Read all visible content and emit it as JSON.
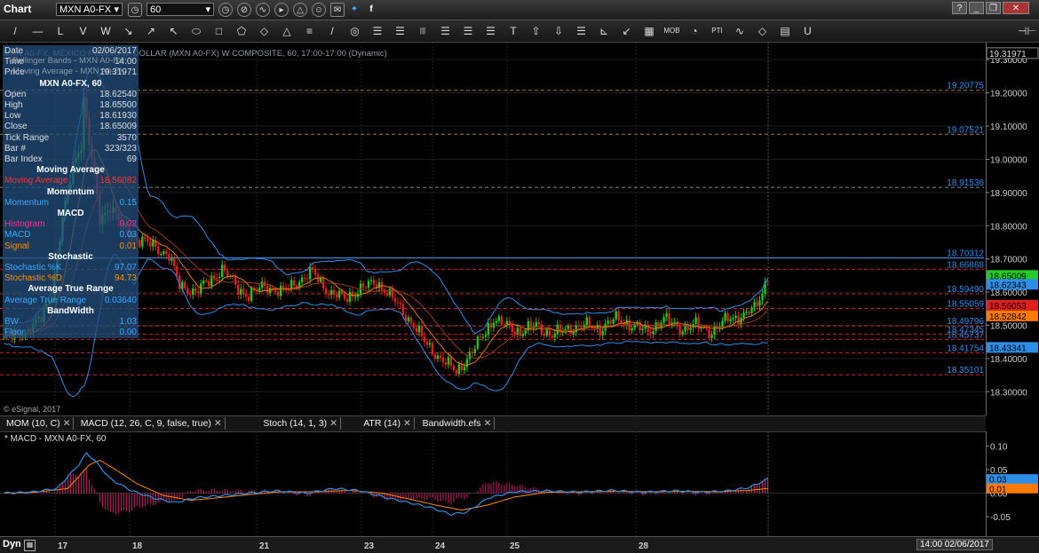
{
  "titlebar": {
    "app_title": "Chart",
    "symbol": "MXN A0-FX",
    "interval": "60",
    "window_buttons": [
      "?",
      "_",
      "❐",
      "✕"
    ]
  },
  "toolbar": {
    "tools": [
      "/",
      "—",
      "L",
      "V",
      "W",
      "↘",
      "↗",
      "↖",
      "⬭",
      "□",
      "⬠",
      "◇",
      "△",
      "≡",
      "/",
      "◎",
      "☰",
      "☰",
      "|||",
      "☰",
      "☰",
      "☰",
      "T",
      "⇧",
      "⇩",
      "☰",
      "⊾",
      "↙",
      "▦",
      "MOB",
      "◔",
      "PTI",
      "∿",
      "◇",
      "▤",
      "U"
    ],
    "right_tools": [
      "⊣⊢"
    ]
  },
  "legend_text": "MXN A0-FX, MEXICO PESO/U.S. DOLLAR (MXN A0-FX) W COMPOSITE, 60, 17:00-17:00 (Dynamic)",
  "data_window": {
    "rows": [
      {
        "k": "Date",
        "v": "02/06/2017"
      },
      {
        "k": "Time",
        "v": "14:00"
      },
      {
        "k": "Price",
        "v": "19.31971"
      },
      {
        "h": "MXN A0-FX, 60"
      },
      {
        "k": "Open",
        "v": "18.62540"
      },
      {
        "k": "High",
        "v": "18.65500"
      },
      {
        "k": "Low",
        "v": "18.61930"
      },
      {
        "k": "Close",
        "v": "18.65009"
      },
      {
        "k": "Tick Range",
        "v": "3570"
      },
      {
        "k": "Bar #",
        "v": "323/323"
      },
      {
        "k": "Bar Index",
        "v": "69"
      },
      {
        "h": "Moving Average"
      },
      {
        "k": "Moving Average",
        "v": "18.56082",
        "c": "#ff3030"
      },
      {
        "h": "Momentum"
      },
      {
        "k": "Momentum",
        "v": "0.15",
        "c": "#33aaff"
      },
      {
        "h": "MACD"
      },
      {
        "k": "Histogram",
        "v": "0.02",
        "c": "#ff2a8a"
      },
      {
        "k": "MACD",
        "v": "0.03",
        "c": "#33aaff"
      },
      {
        "k": "Signal",
        "v": "0.01",
        "c": "#ff8c00"
      },
      {
        "h": "Stochastic"
      },
      {
        "k": "Stochastic %K",
        "v": "97.07",
        "c": "#33aaff"
      },
      {
        "k": "Stochastic %D",
        "v": "94.73",
        "c": "#ff8c00"
      },
      {
        "h": "Average True Range"
      },
      {
        "k": "Average True Range",
        "v": "0.03640",
        "c": "#33aaff"
      },
      {
        "h": "BandWidth"
      },
      {
        "k": "BW",
        "v": "1.03",
        "c": "#33aaff"
      },
      {
        "k": "Floor",
        "v": "0.00",
        "c": "#33aaff"
      }
    ],
    "overlay_labels": [
      "Bollinger Bands - MXN A0-FX",
      "Moving Average - MXN A0-FX"
    ]
  },
  "watermark": "© eSignal, 2017",
  "tabs": [
    {
      "label": "MOM (10, C)"
    },
    {
      "label": "MACD (12, 26, C, 9, false, true)"
    },
    {
      "label": "Stoch (14, 1, 3)"
    },
    {
      "label": "ATR (14)"
    },
    {
      "label": "Bandwidth.efs"
    }
  ],
  "bottom_bar": {
    "dyn": "Dyn",
    "datetime": "14:00 02/06/2017"
  },
  "colors": {
    "up": "#1ec81e",
    "down": "#e02020",
    "band": "#2d8ee8",
    "ma": "#e07a10",
    "level_blue": "#2d8ee8",
    "level_red": "#d02020",
    "level_orange": "#a87a20"
  },
  "chart_data": [
    {
      "type": "candlestick",
      "ylim": [
        18.25,
        19.33
      ],
      "y_ticks": [
        "19.30000",
        "19.20000",
        "19.10000",
        "19.00000",
        "18.90000",
        "18.80000",
        "18.70000",
        "18.60000",
        "18.50000",
        "18.40000",
        "18.30000"
      ],
      "x_labels": [
        "17",
        "18",
        "21",
        "23",
        "24",
        "25",
        "28"
      ],
      "levels": [
        {
          "value": 19.20775,
          "label": "19.20775",
          "kind": "orange"
        },
        {
          "value": 19.07521,
          "label": "19.07521",
          "kind": "orange"
        },
        {
          "value": 18.91536,
          "label": "18.91536",
          "kind": "gray"
        },
        {
          "value": 18.70312,
          "label": "18.70312",
          "kind": "blue"
        },
        {
          "value": 18.66868,
          "label": "18.66868",
          "kind": "red"
        },
        {
          "value": 18.5949,
          "label": "18.59490",
          "kind": "red"
        },
        {
          "value": 18.55059,
          "label": "18.55059",
          "kind": "red"
        },
        {
          "value": 18.49796,
          "label": "18.49796",
          "kind": "red"
        },
        {
          "value": 18.47345,
          "label": "18.47345",
          "kind": "red"
        },
        {
          "value": 18.45737,
          "label": "18.45737",
          "kind": "red"
        },
        {
          "value": 18.41754,
          "label": "18.41754",
          "kind": "red"
        },
        {
          "value": 18.35101,
          "label": "18.35101",
          "kind": "red"
        }
      ],
      "price_tags": [
        {
          "value": 19.31971,
          "label": "19.31971",
          "bg": "#000000",
          "fg": "#dddddd"
        },
        {
          "value": 18.65009,
          "label": "18.65009",
          "bg": "#22cc22",
          "fg": "#000000"
        },
        {
          "value": 18.62343,
          "label": "18.62343",
          "bg": "#2d8ee8",
          "fg": "#000000"
        },
        {
          "value": 18.56053,
          "label": "18.56053",
          "bg": "#e02020",
          "fg": "#000000"
        },
        {
          "value": 18.52842,
          "label": "18.52842",
          "bg": "#ff7a00",
          "fg": "#000000"
        },
        {
          "value": 18.43341,
          "label": "18.43341",
          "bg": "#2d8ee8",
          "fg": "#000000"
        }
      ],
      "close_anchors": [
        [
          0,
          18.46
        ],
        [
          8,
          18.48
        ],
        [
          14,
          18.52
        ],
        [
          18,
          18.6
        ],
        [
          22,
          18.82
        ],
        [
          26,
          18.98
        ],
        [
          29,
          19.05
        ],
        [
          30,
          19.18
        ],
        [
          32,
          19.05
        ],
        [
          34,
          18.95
        ],
        [
          36,
          18.82
        ],
        [
          40,
          18.86
        ],
        [
          44,
          18.8
        ],
        [
          50,
          18.76
        ],
        [
          56,
          18.74
        ],
        [
          62,
          18.71
        ],
        [
          66,
          18.62
        ],
        [
          72,
          18.6
        ],
        [
          78,
          18.64
        ],
        [
          82,
          18.67
        ],
        [
          88,
          18.61
        ],
        [
          92,
          18.59
        ],
        [
          98,
          18.62
        ],
        [
          104,
          18.6
        ],
        [
          110,
          18.63
        ],
        [
          116,
          18.66
        ],
        [
          122,
          18.6
        ],
        [
          128,
          18.58
        ],
        [
          134,
          18.61
        ],
        [
          140,
          18.63
        ],
        [
          144,
          18.6
        ],
        [
          150,
          18.54
        ],
        [
          154,
          18.5
        ],
        [
          158,
          18.45
        ],
        [
          164,
          18.4
        ],
        [
          170,
          18.36
        ],
        [
          176,
          18.42
        ],
        [
          180,
          18.47
        ],
        [
          184,
          18.52
        ],
        [
          188,
          18.5
        ],
        [
          194,
          18.48
        ],
        [
          200,
          18.5
        ],
        [
          206,
          18.47
        ],
        [
          212,
          18.49
        ],
        [
          218,
          18.5
        ],
        [
          224,
          18.49
        ],
        [
          230,
          18.52
        ],
        [
          236,
          18.5
        ],
        [
          242,
          18.48
        ],
        [
          248,
          18.52
        ],
        [
          254,
          18.49
        ],
        [
          260,
          18.5
        ],
        [
          266,
          18.48
        ],
        [
          272,
          18.52
        ],
        [
          278,
          18.53
        ],
        [
          282,
          18.55
        ],
        [
          285,
          18.6
        ],
        [
          287,
          18.65
        ]
      ],
      "bar_count": 288
    },
    {
      "type": "line",
      "title": "* MACD - MXN A0-FX, 60",
      "ylim": [
        -0.08,
        0.12
      ],
      "y_ticks": [
        "0.10",
        "0.05",
        "0.00",
        "-0.05"
      ],
      "value_tags": [
        {
          "value": 0.03,
          "label": "0.03",
          "bg": "#2d8ee8"
        },
        {
          "value": 0.01,
          "label": "0.01",
          "bg": "#ff7a00"
        }
      ],
      "macd_anchors": [
        [
          0,
          0.0
        ],
        [
          10,
          0.002
        ],
        [
          20,
          0.01
        ],
        [
          28,
          0.06
        ],
        [
          31,
          0.085
        ],
        [
          34,
          0.07
        ],
        [
          40,
          0.03
        ],
        [
          48,
          0.005
        ],
        [
          56,
          -0.01
        ],
        [
          64,
          -0.02
        ],
        [
          72,
          -0.01
        ],
        [
          82,
          -0.005
        ],
        [
          92,
          0.0
        ],
        [
          102,
          0.005
        ],
        [
          114,
          0.0
        ],
        [
          124,
          0.01
        ],
        [
          134,
          0.005
        ],
        [
          144,
          -0.01
        ],
        [
          152,
          -0.02
        ],
        [
          160,
          -0.03
        ],
        [
          168,
          -0.045
        ],
        [
          174,
          -0.04
        ],
        [
          182,
          -0.01
        ],
        [
          192,
          0.003
        ],
        [
          204,
          0.005
        ],
        [
          216,
          0.002
        ],
        [
          228,
          0.006
        ],
        [
          240,
          0.002
        ],
        [
          252,
          0.005
        ],
        [
          262,
          0.002
        ],
        [
          272,
          0.005
        ],
        [
          280,
          0.012
        ],
        [
          287,
          0.03
        ]
      ],
      "signal_anchors": [
        [
          0,
          0.0
        ],
        [
          12,
          0.002
        ],
        [
          24,
          0.01
        ],
        [
          32,
          0.06
        ],
        [
          36,
          0.07
        ],
        [
          42,
          0.05
        ],
        [
          50,
          0.02
        ],
        [
          60,
          -0.005
        ],
        [
          70,
          -0.015
        ],
        [
          80,
          -0.01
        ],
        [
          92,
          -0.003
        ],
        [
          104,
          0.003
        ],
        [
          118,
          0.003
        ],
        [
          130,
          0.006
        ],
        [
          142,
          0.0
        ],
        [
          152,
          -0.012
        ],
        [
          162,
          -0.025
        ],
        [
          172,
          -0.036
        ],
        [
          182,
          -0.025
        ],
        [
          192,
          -0.008
        ],
        [
          204,
          0.002
        ],
        [
          218,
          0.003
        ],
        [
          230,
          0.004
        ],
        [
          244,
          0.003
        ],
        [
          256,
          0.004
        ],
        [
          268,
          0.003
        ],
        [
          280,
          0.006
        ],
        [
          287,
          0.01
        ]
      ]
    }
  ]
}
